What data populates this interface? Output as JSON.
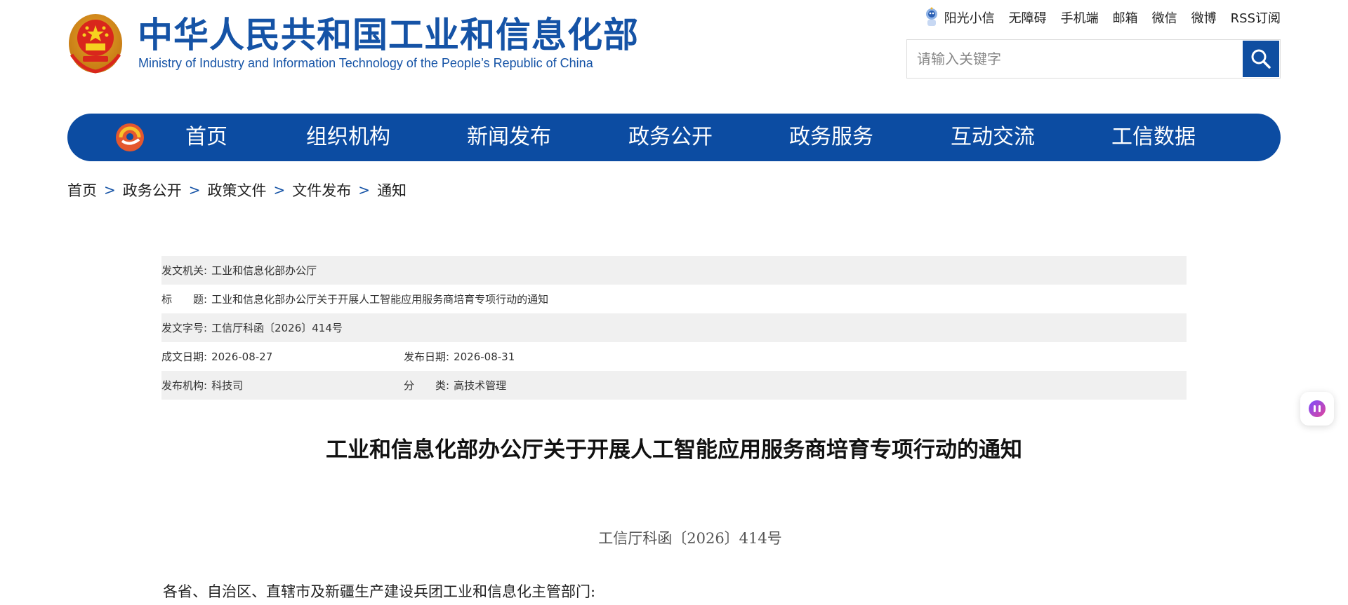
{
  "header": {
    "title_cn": "中华人民共和国工业和信息化部",
    "title_en": "Ministry of Industry and Information Technology of the People’s Republic of China",
    "brand_color": "#1553a6",
    "toplinks": [
      "阳光小信",
      "无障碍",
      "手机端",
      "邮箱",
      "微信",
      "微博",
      "RSS订阅"
    ],
    "search_placeholder": "请输入关键字"
  },
  "nav": {
    "bg_color": "#0c4ca2",
    "items": [
      "首页",
      "组织机构",
      "新闻发布",
      "政务公开",
      "政务服务",
      "互动交流",
      "工信数据"
    ]
  },
  "breadcrumb": [
    "首页",
    "政务公开",
    "政策文件",
    "文件发布",
    "通知"
  ],
  "breadcrumb_sep": ">",
  "info": {
    "issuer_label": "发文机关:",
    "issuer": "工业和信息化部办公厅",
    "title_label": "标　　题:",
    "title": "工业和信息化部办公厅关于开展人工智能应用服务商培育专项行动的通知",
    "docno_label": "发文字号:",
    "docno": "工信厅科函〔2026〕414号",
    "created_label": "成文日期:",
    "created": "2026-08-27",
    "published_label": "发布日期:",
    "published": "2026-08-31",
    "org_label": "发布机构:",
    "org": "科技司",
    "category_label": "分　　类:",
    "category": "高技术管理"
  },
  "article": {
    "title": "工业和信息化部办公厅关于开展人工智能应用服务商培育专项行动的通知",
    "doc_no": "工信厅科函〔2026〕414号",
    "greeting": "各省、自治区、直辖市及新疆生产建设兵团工业和信息化主管部门:"
  }
}
